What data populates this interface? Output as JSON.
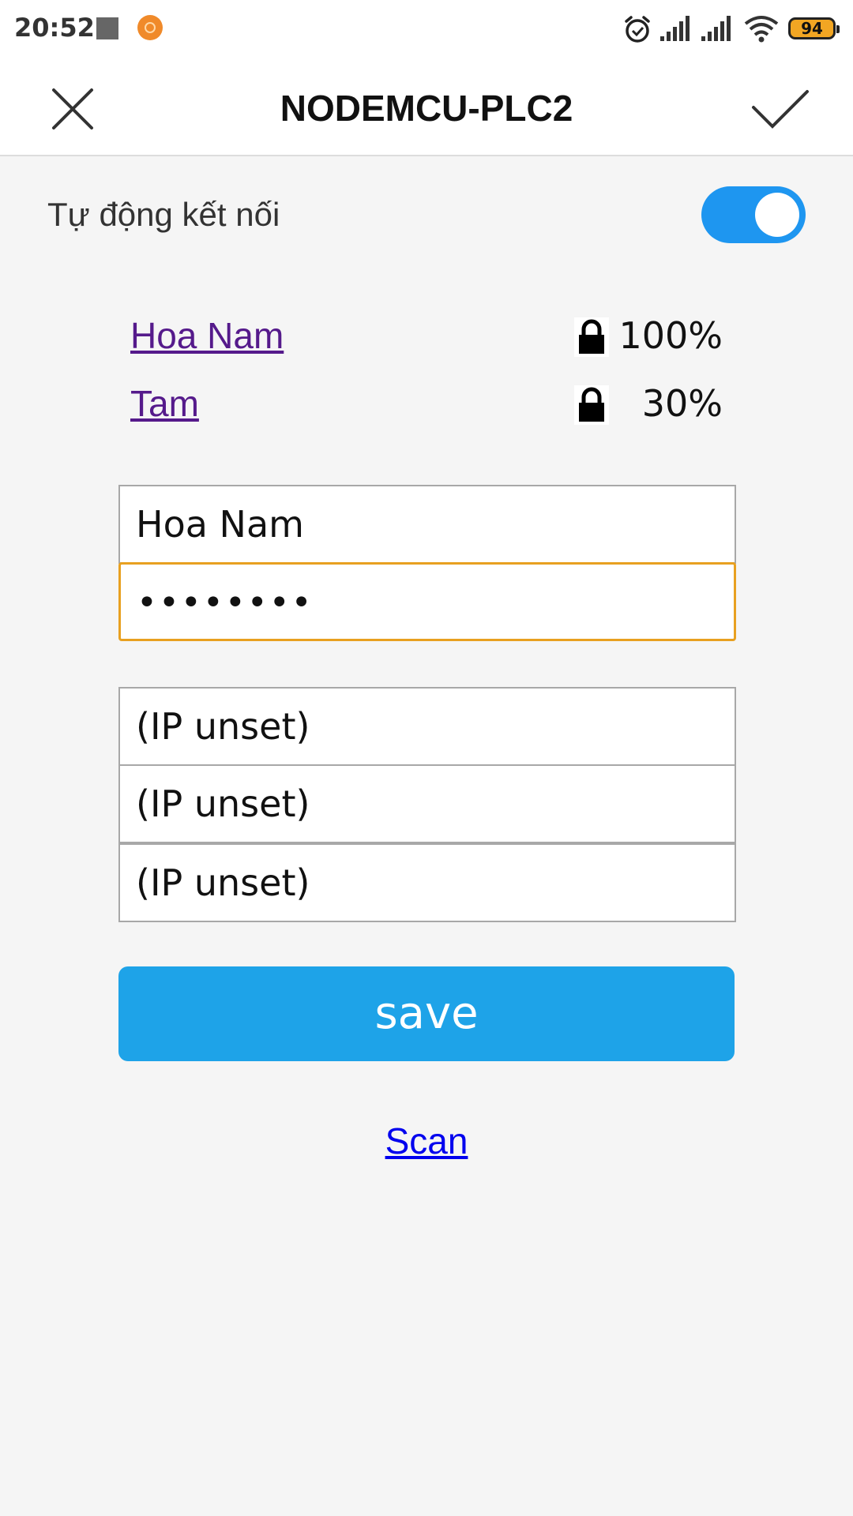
{
  "status_bar": {
    "time": "20:52",
    "battery": "94",
    "icons": [
      "stop-square-icon",
      "orange-app-icon",
      "alarm-icon",
      "signal-icon",
      "signal-icon",
      "wifi-icon",
      "battery-icon"
    ]
  },
  "header": {
    "title": "NODEMCU-PLC2",
    "close_icon": "close-icon",
    "confirm_icon": "check-icon"
  },
  "auto_connect": {
    "label": "Tự động kết nối",
    "enabled": true,
    "accent_color": "#1e96f0"
  },
  "networks": [
    {
      "ssid": "Hoa Nam",
      "signal": "100%",
      "secured": true
    },
    {
      "ssid": "Tam",
      "signal": "30%",
      "secured": true
    }
  ],
  "form": {
    "ssid_value": "Hoa Nam",
    "password_value": "••••••••",
    "ip_fields": [
      "(IP unset)",
      "(IP unset)",
      "(IP unset)"
    ],
    "save_label": "save",
    "save_color": "#1ea3e8"
  },
  "scan_label": "Scan"
}
